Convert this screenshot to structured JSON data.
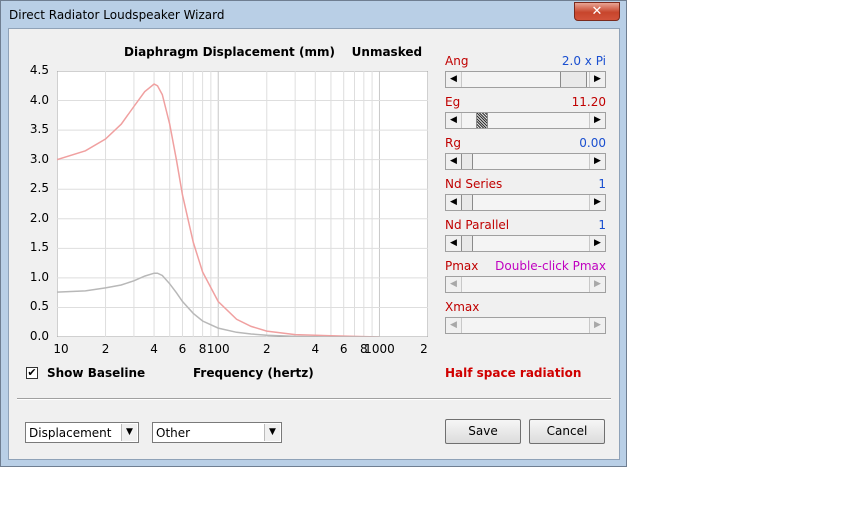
{
  "window": {
    "title": "Direct Radiator Loudspeaker Wizard",
    "close_glyph": "✕"
  },
  "chart_data": {
    "type": "line",
    "title": "Diaphragm Displacement (mm)",
    "masking": "Unmasked",
    "xlabel": "Frequency (hertz)",
    "ylabel": "",
    "x_scale": "log",
    "xlim": [
      10,
      2000
    ],
    "ylim": [
      0,
      4.5
    ],
    "yticks": [
      "4.5",
      "4.0",
      "3.5",
      "3.0",
      "2.5",
      "2.0",
      "1.5",
      "1.0",
      "0.5",
      "0.0"
    ],
    "xticks": [
      "10",
      "2",
      "4",
      "6",
      "8",
      "100",
      "2",
      "4",
      "6",
      "8",
      "1000",
      "2"
    ],
    "grid": true,
    "series": [
      {
        "color": "#f0a0a0",
        "points": [
          [
            10,
            3.0
          ],
          [
            15,
            3.15
          ],
          [
            20,
            3.35
          ],
          [
            25,
            3.6
          ],
          [
            30,
            3.9
          ],
          [
            35,
            4.15
          ],
          [
            40,
            4.28
          ],
          [
            42,
            4.25
          ],
          [
            45,
            4.1
          ],
          [
            50,
            3.6
          ],
          [
            55,
            3.0
          ],
          [
            60,
            2.4
          ],
          [
            70,
            1.6
          ],
          [
            80,
            1.1
          ],
          [
            100,
            0.6
          ],
          [
            130,
            0.3
          ],
          [
            160,
            0.18
          ],
          [
            200,
            0.1
          ],
          [
            300,
            0.04
          ],
          [
            500,
            0.02
          ],
          [
            700,
            0.01
          ],
          [
            1000,
            0.0
          ]
        ]
      },
      {
        "color": "#b8b8b8",
        "points": [
          [
            10,
            0.76
          ],
          [
            15,
            0.78
          ],
          [
            20,
            0.83
          ],
          [
            25,
            0.88
          ],
          [
            30,
            0.95
          ],
          [
            35,
            1.03
          ],
          [
            40,
            1.08
          ],
          [
            42,
            1.08
          ],
          [
            45,
            1.04
          ],
          [
            50,
            0.9
          ],
          [
            55,
            0.75
          ],
          [
            60,
            0.6
          ],
          [
            70,
            0.4
          ],
          [
            80,
            0.27
          ],
          [
            100,
            0.15
          ],
          [
            130,
            0.08
          ],
          [
            160,
            0.05
          ],
          [
            200,
            0.03
          ],
          [
            300,
            0.01
          ],
          [
            500,
            0.0
          ],
          [
            1000,
            0.0
          ]
        ]
      }
    ]
  },
  "params": {
    "ang": {
      "label": "Ang",
      "value": "2.0 x Pi",
      "value_color": "#1a4fd0",
      "thumb_pos": 0.8
    },
    "eg": {
      "label": "Eg",
      "value": "11.20",
      "value_color": "#c00000",
      "thumb_pos": 0.15
    },
    "rg": {
      "label": "Rg",
      "value": "0.00",
      "value_color": "#1a4fd0",
      "thumb_pos": 0.0
    },
    "nd_series": {
      "label": "Nd  Series",
      "value": "1",
      "value_color": "#1a4fd0",
      "thumb_pos": 0.0
    },
    "nd_parallel": {
      "label": "Nd  Parallel",
      "value": "1",
      "value_color": "#1a4fd0",
      "thumb_pos": 0.0
    },
    "pmax": {
      "label": "Pmax",
      "value": "Double-click Pmax",
      "value_color": "#c000c0"
    },
    "xmax": {
      "label": "Xmax",
      "value": ""
    }
  },
  "baseline": {
    "label": "Show Baseline",
    "checked": true,
    "check_glyph": "✔"
  },
  "radiation_text": "Half space radiation",
  "combo_left": {
    "value": "Displacement"
  },
  "combo_right": {
    "value": "Other"
  },
  "buttons": {
    "save": "Save",
    "cancel": "Cancel"
  }
}
